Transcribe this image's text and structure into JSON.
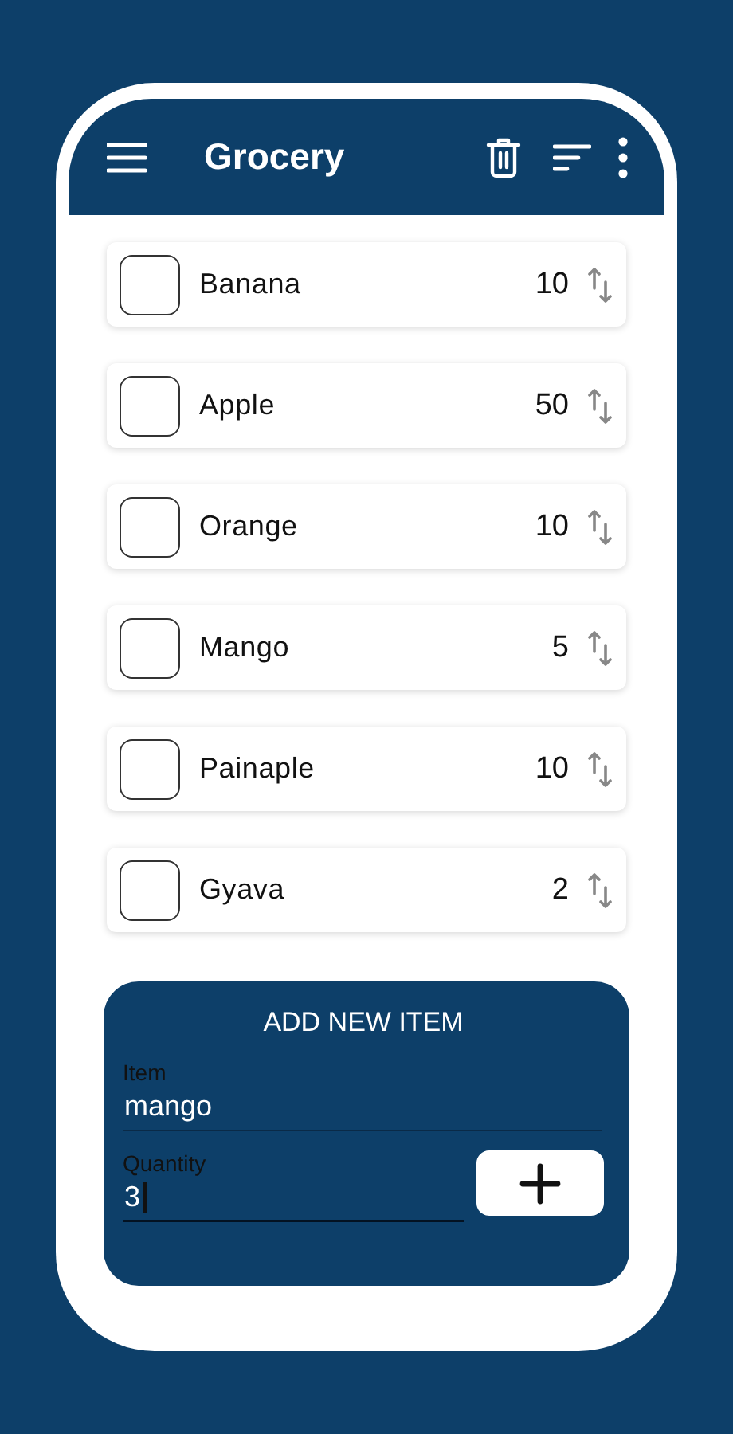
{
  "app_bar": {
    "title": "Grocery"
  },
  "items": [
    {
      "name": "Banana",
      "quantity": "10",
      "checked": false
    },
    {
      "name": "Apple",
      "quantity": "50",
      "checked": false
    },
    {
      "name": "Orange",
      "quantity": "10",
      "checked": false
    },
    {
      "name": "Mango",
      "quantity": "5",
      "checked": false
    },
    {
      "name": "Painaple",
      "quantity": "10",
      "checked": false
    },
    {
      "name": "Gyava",
      "quantity": "2",
      "checked": false
    }
  ],
  "add_form": {
    "title": "ADD NEW ITEM",
    "fields": [
      {
        "label": "Item",
        "value": "mango",
        "focused": false
      },
      {
        "label": "Quantity",
        "value": "3",
        "focused": true
      }
    ]
  }
}
